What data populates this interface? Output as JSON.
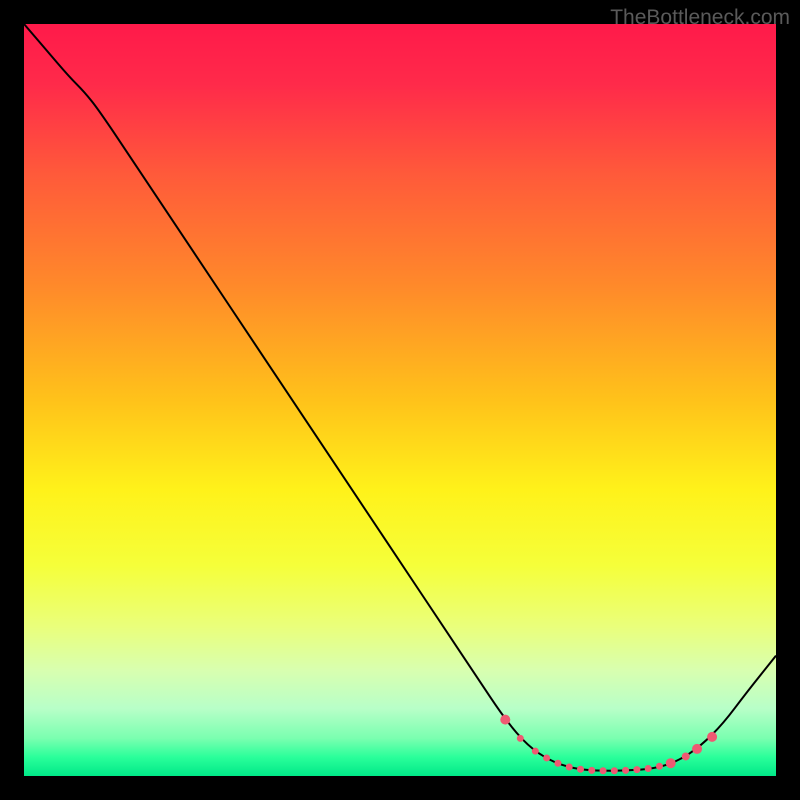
{
  "watermark": "TheBottleneck.com",
  "chart_data": {
    "type": "line",
    "title": "",
    "xlabel": "",
    "ylabel": "",
    "xlim": [
      0,
      100
    ],
    "ylim": [
      0,
      100
    ],
    "gradient_stops": [
      {
        "offset": 0.0,
        "color": "#ff1a4a"
      },
      {
        "offset": 0.08,
        "color": "#ff2a4a"
      },
      {
        "offset": 0.2,
        "color": "#ff5a3a"
      },
      {
        "offset": 0.35,
        "color": "#ff8a2a"
      },
      {
        "offset": 0.5,
        "color": "#ffc21a"
      },
      {
        "offset": 0.62,
        "color": "#fff21a"
      },
      {
        "offset": 0.72,
        "color": "#f5ff3a"
      },
      {
        "offset": 0.8,
        "color": "#eaff7a"
      },
      {
        "offset": 0.86,
        "color": "#d8ffb0"
      },
      {
        "offset": 0.91,
        "color": "#b8ffc8"
      },
      {
        "offset": 0.95,
        "color": "#7affb0"
      },
      {
        "offset": 0.975,
        "color": "#2aff9a"
      },
      {
        "offset": 1.0,
        "color": "#00e888"
      }
    ],
    "series": [
      {
        "name": "bottleneck-curve",
        "stroke": "#000000",
        "stroke_width": 2,
        "points": [
          {
            "x": 0,
            "y": 100
          },
          {
            "x": 3,
            "y": 96.5
          },
          {
            "x": 6,
            "y": 93
          },
          {
            "x": 8,
            "y": 91
          },
          {
            "x": 10,
            "y": 88.5
          },
          {
            "x": 15,
            "y": 81
          },
          {
            "x": 20,
            "y": 73.5
          },
          {
            "x": 25,
            "y": 66
          },
          {
            "x": 30,
            "y": 58.5
          },
          {
            "x": 35,
            "y": 51
          },
          {
            "x": 40,
            "y": 43.5
          },
          {
            "x": 45,
            "y": 36
          },
          {
            "x": 50,
            "y": 28.5
          },
          {
            "x": 55,
            "y": 21
          },
          {
            "x": 60,
            "y": 13.5
          },
          {
            "x": 64,
            "y": 7.5
          },
          {
            "x": 67,
            "y": 4
          },
          {
            "x": 70,
            "y": 2
          },
          {
            "x": 73,
            "y": 1
          },
          {
            "x": 76,
            "y": 0.7
          },
          {
            "x": 80,
            "y": 0.7
          },
          {
            "x": 84,
            "y": 1
          },
          {
            "x": 87,
            "y": 2
          },
          {
            "x": 90,
            "y": 4
          },
          {
            "x": 93,
            "y": 7
          },
          {
            "x": 96,
            "y": 11
          },
          {
            "x": 100,
            "y": 16
          }
        ]
      }
    ],
    "markers": {
      "color": "#ee5a72",
      "radius_small": 3.5,
      "radius_large": 5,
      "points": [
        {
          "x": 64,
          "y": 7.5,
          "r": 5
        },
        {
          "x": 66,
          "y": 5,
          "r": 3.5
        },
        {
          "x": 68,
          "y": 3.3,
          "r": 3.5
        },
        {
          "x": 69.5,
          "y": 2.4,
          "r": 3.5
        },
        {
          "x": 71,
          "y": 1.7,
          "r": 3.5
        },
        {
          "x": 72.5,
          "y": 1.2,
          "r": 3.5
        },
        {
          "x": 74,
          "y": 0.9,
          "r": 3.5
        },
        {
          "x": 75.5,
          "y": 0.75,
          "r": 3.5
        },
        {
          "x": 77,
          "y": 0.7,
          "r": 3.5
        },
        {
          "x": 78.5,
          "y": 0.7,
          "r": 3.5
        },
        {
          "x": 80,
          "y": 0.75,
          "r": 3.5
        },
        {
          "x": 81.5,
          "y": 0.85,
          "r": 3.5
        },
        {
          "x": 83,
          "y": 1.0,
          "r": 3.5
        },
        {
          "x": 84.5,
          "y": 1.3,
          "r": 3.5
        },
        {
          "x": 86,
          "y": 1.7,
          "r": 5
        },
        {
          "x": 88,
          "y": 2.6,
          "r": 4
        },
        {
          "x": 89.5,
          "y": 3.6,
          "r": 5
        },
        {
          "x": 91.5,
          "y": 5.2,
          "r": 5
        }
      ]
    }
  }
}
